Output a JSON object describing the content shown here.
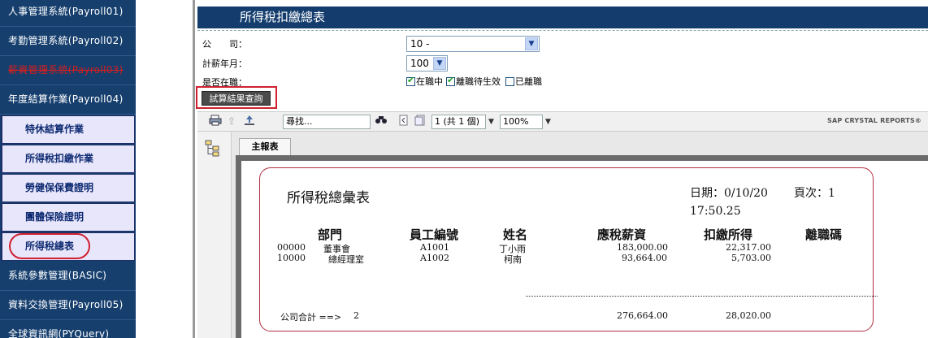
{
  "sidebar": {
    "items": [
      {
        "label": "人事管理系統(Payroll01)"
      },
      {
        "label": "考勤管理系統(Payroll02)"
      },
      {
        "label": "薪資管理系統(Payroll03)"
      },
      {
        "label": "年度結算作業(Payroll04)"
      },
      {
        "label": "系統參數管理(BASIC)"
      },
      {
        "label": "資料交換管理(Payroll05)"
      },
      {
        "label": "全球資訊網(PYQuery)"
      }
    ],
    "subitems": [
      {
        "label": "特休結算作業"
      },
      {
        "label": "所得稅扣繳作業"
      },
      {
        "label": "勞健保保費證明"
      },
      {
        "label": "團體保險證明"
      },
      {
        "label": "所得稅總表"
      }
    ]
  },
  "page": {
    "title": "所得稅扣繳總表"
  },
  "form": {
    "company_label": "公　　司：",
    "company_value": "10 -",
    "month_label": "計薪年月：",
    "month_value": "100",
    "status_label": "是否在職：",
    "status_options": [
      {
        "label": "在職中",
        "checked": true
      },
      {
        "label": "離職待生效",
        "checked": true
      },
      {
        "label": "已離職",
        "checked": false
      }
    ],
    "query_button": "試算結果查詢"
  },
  "toolbar": {
    "search_placeholder": "尋找...",
    "page_value": "1 (共 1 個)",
    "zoom_value": "100%",
    "brand": "SAP CRYSTAL REPORTS®"
  },
  "report": {
    "tab_label": "主報表",
    "title": "所得稅總彙表",
    "date_label": "日期：0/10/20",
    "page_label": "頁次：1",
    "time": "17:50.25",
    "columns": [
      "部門",
      "員工編號",
      "姓名",
      "應稅薪資",
      "扣繳所得",
      "離職碼"
    ],
    "rows": [
      {
        "dept_code": "00000",
        "dept_name": "董事會",
        "emp_id": "A1001",
        "name": "丁小雨",
        "salary": "183,000.00",
        "withheld": "22,317.00"
      },
      {
        "dept_code": "10000",
        "dept_name": "總經理室",
        "emp_id": "A1002",
        "name": "柯南",
        "salary": "93,664.00",
        "withheld": "5,703.00"
      }
    ],
    "total_label": "公司合計 ==>",
    "total_count": "2",
    "total_salary": "276,664.00",
    "total_withheld": "28,020.00"
  }
}
